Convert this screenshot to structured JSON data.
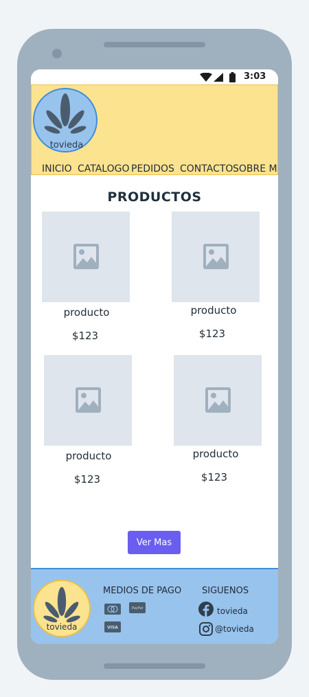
{
  "status_bar": {
    "time": "3:03"
  },
  "header": {
    "logo_text": "tovieda",
    "nav": [
      "INICIO",
      "CATALOGO",
      "PEDIDOS",
      "CONTACTO",
      "SOBRE MI"
    ]
  },
  "main": {
    "title": "PRODUCTOS",
    "products": [
      {
        "name": "producto",
        "price": "$123"
      },
      {
        "name": "producto",
        "price": "$123"
      },
      {
        "name": "producto",
        "price": "$123"
      },
      {
        "name": "producto",
        "price": "$123"
      }
    ],
    "more_button": "Ver Mas"
  },
  "footer": {
    "logo_text": "tovieda",
    "payment_heading": "MEDIOS DE PAGO",
    "social_heading": "SIGUENOS",
    "payment_icons": [
      "mastercard-icon",
      "paypal-icon",
      "visa-icon"
    ],
    "paypal_label": "PayPal",
    "visa_label": "VISA",
    "social": [
      {
        "icon": "facebook-icon",
        "label": "tovieda"
      },
      {
        "icon": "instagram-icon",
        "label": "@tovieda"
      }
    ]
  },
  "colors": {
    "header_bg": "#fce38f",
    "footer_bg": "#98c3ed",
    "accent_button": "#6a5ef1",
    "logo_leaf": "#4a5d6e"
  }
}
